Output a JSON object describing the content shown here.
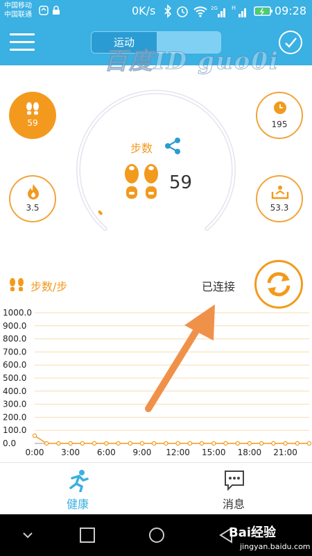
{
  "status_bar": {
    "carrier_1": "中国移动",
    "carrier_2": "中国联通",
    "net_speed": "0K/s",
    "time": "09:28"
  },
  "header": {
    "tab_sport": "运动",
    "tab_sleep": "",
    "watermark": "百度ID guo0i"
  },
  "widgets": {
    "steps_value": "59",
    "time_value": "195",
    "calorie_value": "3.5",
    "distance_value": "53.3"
  },
  "gauge": {
    "label": "步数",
    "value": "59",
    "progress": 0.006
  },
  "chart_header": {
    "legend_label": "步数/步",
    "connection_status": "已连接"
  },
  "chart_data": {
    "type": "line",
    "x": [
      "0:00",
      "1:00",
      "2:00",
      "3:00",
      "4:00",
      "5:00",
      "6:00",
      "7:00",
      "8:00",
      "9:00",
      "10:00",
      "11:00",
      "12:00",
      "13:00",
      "14:00",
      "15:00",
      "16:00",
      "17:00",
      "18:00",
      "19:00",
      "20:00",
      "21:00",
      "22:00",
      "23:00"
    ],
    "x_tick_labels": [
      "0:00",
      "3:00",
      "6:00",
      "9:00",
      "12:00",
      "15:00",
      "18:00",
      "21:00"
    ],
    "series": [
      {
        "values": [
          59,
          0,
          0,
          0,
          0,
          0,
          0,
          0,
          0,
          0,
          0,
          0,
          0,
          0,
          0,
          0,
          0,
          0,
          0,
          0,
          0,
          0,
          0,
          0
        ]
      }
    ],
    "y_tick_labels": [
      "0.0",
      "100.0",
      "200.0",
      "300.0",
      "400.0",
      "500.0",
      "600.0",
      "700.0",
      "800.0",
      "900.0",
      "1000.0"
    ],
    "ylim": [
      0,
      1000
    ],
    "grid": true,
    "colors": {
      "line": "#f29a1d",
      "grid": "#f8dcb0"
    }
  },
  "bottom_nav": {
    "health": "健康",
    "messages": "消息"
  },
  "system_bar": {
    "brand": "Bai经验",
    "brand_sub": "jingyan.baidu.com"
  },
  "colors": {
    "primary": "#3ab0e3",
    "accent": "#f29a1d"
  }
}
